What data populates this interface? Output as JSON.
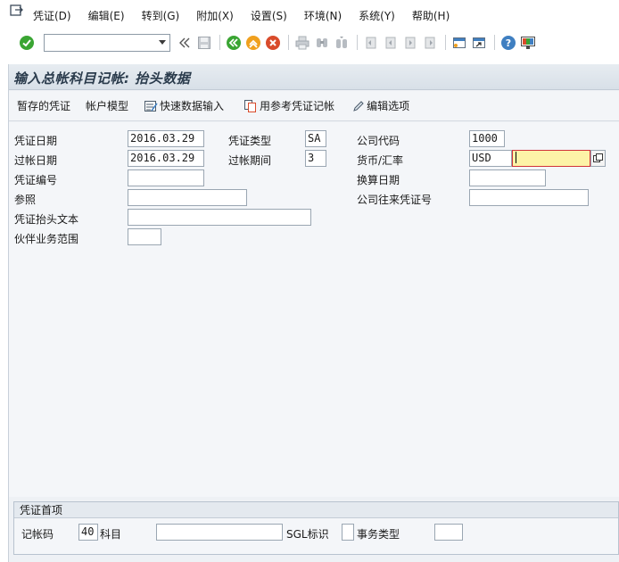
{
  "menu": {
    "items": [
      "凭证(D)",
      "编辑(E)",
      "转到(G)",
      "附加(X)",
      "设置(S)",
      "环境(N)",
      "系统(Y)",
      "帮助(H)"
    ]
  },
  "toolbar": {
    "command_value": ""
  },
  "screen": {
    "title": "输入总帐科目记帐: 抬头数据",
    "app_buttons": [
      "暂存的凭证",
      "帐户模型",
      "快速数据输入",
      "用参考凭证记帐",
      "编辑选项"
    ]
  },
  "form": {
    "doc_date_label": "凭证日期",
    "doc_date": "2016.03.29",
    "doc_type_label": "凭证类型",
    "doc_type": "SA",
    "company_code_label": "公司代码",
    "company_code": "1000",
    "posting_date_label": "过帐日期",
    "posting_date": "2016.03.29",
    "period_label": "过帐期间",
    "period": "3",
    "currency_label": "货币/汇率",
    "currency": "USD",
    "exchange_rate": "",
    "doc_number_label": "凭证编号",
    "doc_number": "",
    "translation_date_label": "换算日期",
    "translation_date": "",
    "reference_label": "参照",
    "reference": "",
    "cross_cc_label": "公司往来凭证号",
    "cross_cc": "",
    "header_text_label": "凭证抬头文本",
    "header_text": "",
    "partner_ba_label": "伙伴业务范围",
    "partner_ba": ""
  },
  "first_line": {
    "title": "凭证首项",
    "posting_key_label": "记帐码",
    "posting_key": "40",
    "account_label": "科目",
    "account": "",
    "sgl_label": "SGL标识",
    "sgl": "",
    "trans_type_label": "事务类型",
    "trans_type": ""
  },
  "colors": {
    "accent_green": "#3aa533",
    "accent_orange": "#f0a01e",
    "accent_red": "#d94b2b",
    "focus_field": "#fdf3a7"
  }
}
